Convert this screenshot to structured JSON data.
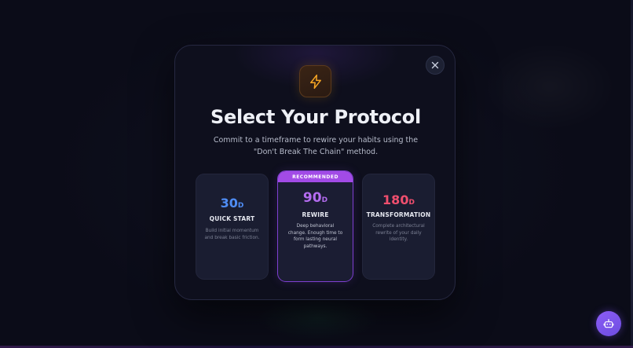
{
  "modal": {
    "icon": "lightning-bolt-icon",
    "title": "Select Your Protocol",
    "subtitle": "Commit to a timeframe to rewire your habits using the \"Don't Break The Chain\" method.",
    "close_icon": "close-icon"
  },
  "plans": [
    {
      "days": "30",
      "unit": "D",
      "name": "QUICK START",
      "description": "Build initial momentum and break basic friction.",
      "color": "#4f8df5"
    },
    {
      "badge": "RECOMMENDED",
      "days": "90",
      "unit": "D",
      "name": "REWIRE",
      "description": "Deep behavioral change. Enough time to form lasting neural pathways.",
      "color": "#b46cf0"
    },
    {
      "days": "180",
      "unit": "D",
      "name": "TRANSFORMATION",
      "description": "Complete architectural rewrite of your daily identity.",
      "color": "#f04f6e"
    }
  ],
  "assistant_button": {
    "icon": "robot-icon",
    "color": "#8b5cf6"
  },
  "colors": {
    "background": "#0b0c18",
    "modal": "#0e0f1d",
    "card": "#1a1d31",
    "accent_purple": "#a24be6",
    "bolt": "#f5a524"
  }
}
